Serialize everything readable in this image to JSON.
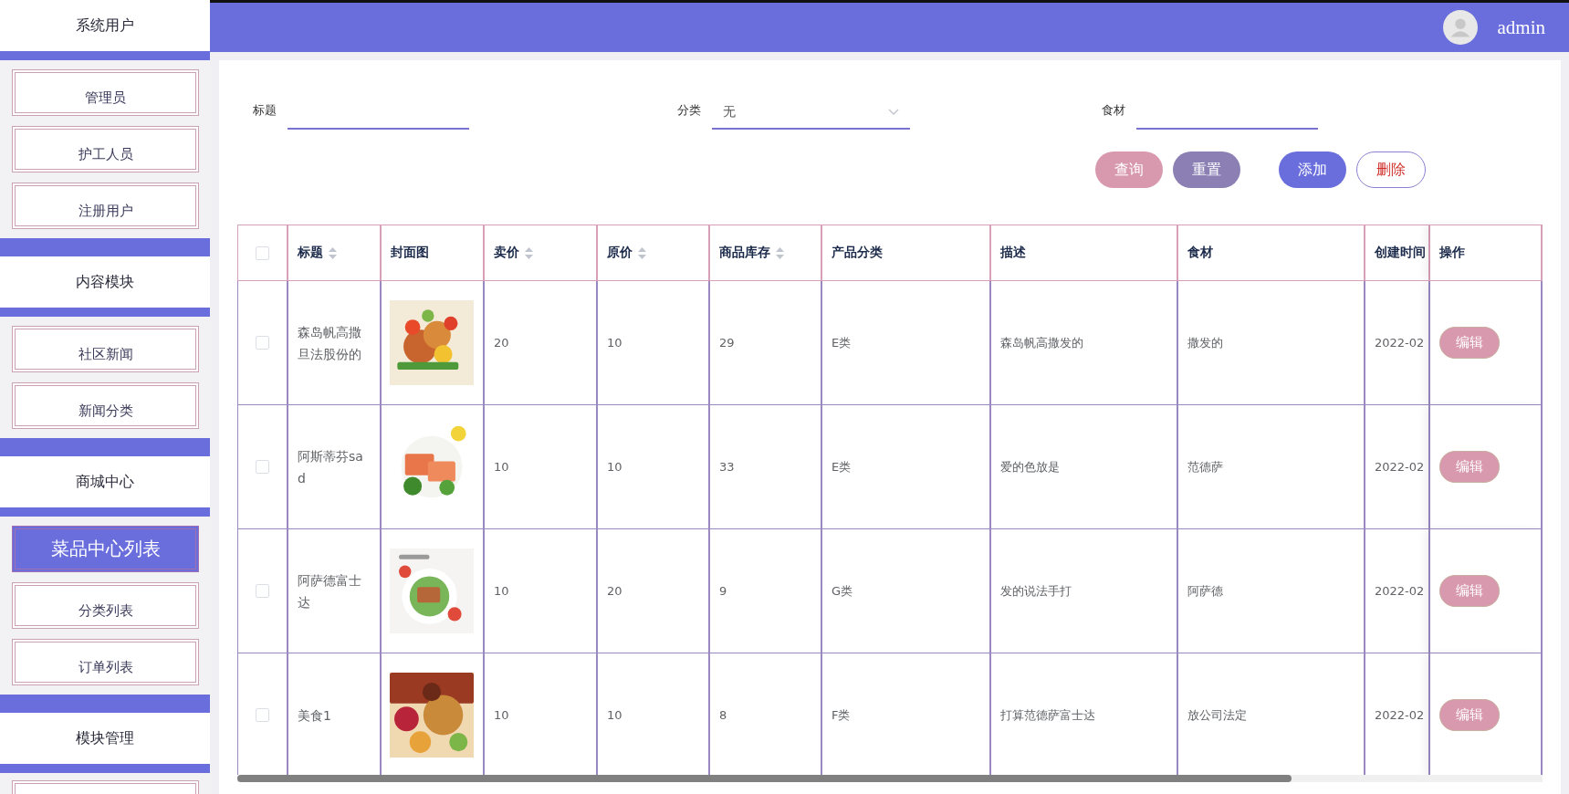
{
  "sidebar": {
    "sections": [
      {
        "title": "系统用户",
        "items": [
          {
            "label": "管理员",
            "selected": false
          },
          {
            "label": "护工人员",
            "selected": false
          },
          {
            "label": "注册用户",
            "selected": false
          }
        ]
      },
      {
        "title": "内容模块",
        "items": [
          {
            "label": "社区新闻",
            "selected": false
          },
          {
            "label": "新闻分类",
            "selected": false
          }
        ]
      },
      {
        "title": "商城中心",
        "items": [
          {
            "label": "菜品中心列表",
            "selected": true
          },
          {
            "label": "分类列表",
            "selected": false
          },
          {
            "label": "订单列表",
            "selected": false
          }
        ]
      },
      {
        "title": "模块管理"
      }
    ]
  },
  "topbar": {
    "username": "admin"
  },
  "filters": [
    {
      "label": "标题",
      "kind": "input"
    },
    {
      "label": "分类",
      "kind": "select",
      "value": "无"
    },
    {
      "label": "食材",
      "kind": "input"
    }
  ],
  "buttons": [
    {
      "label": "查询",
      "kind": "search"
    },
    {
      "label": "重置",
      "kind": "reset"
    },
    {
      "label": "添加",
      "kind": "add"
    },
    {
      "label": "删除",
      "kind": "delete"
    }
  ],
  "table": {
    "select_all_checked": false,
    "columns": [
      {
        "title": "标题",
        "sortable": true
      },
      {
        "title": "封面图",
        "sortable": false
      },
      {
        "title": "卖价",
        "sortable": true
      },
      {
        "title": "原价",
        "sortable": true
      },
      {
        "title": "商品库存",
        "sortable": true
      },
      {
        "title": "产品分类",
        "sortable": false
      },
      {
        "title": "描述",
        "sortable": false
      },
      {
        "title": "食材",
        "sortable": false
      },
      {
        "title": "创建时间",
        "sortable": false
      },
      {
        "title": "操作",
        "sortable": false
      }
    ],
    "rows": [
      {
        "checked": false,
        "cells": [
          "森岛帆高撒旦法股份的",
          {
            "kind": "picture"
          },
          "20",
          "10",
          "29",
          "E类",
          "森岛帆高撒发的",
          "撒发的",
          "2022-02"
        ],
        "action": "编辑"
      },
      {
        "checked": false,
        "cells": [
          "阿斯蒂芬sad",
          {
            "kind": "picture"
          },
          "10",
          "10",
          "33",
          "E类",
          "爱的色放是",
          "范德萨",
          "2022-02"
        ],
        "action": "编辑"
      },
      {
        "checked": false,
        "cells": [
          "阿萨德富士达",
          {
            "kind": "picture"
          },
          "10",
          "20",
          "9",
          "G类",
          "发的说法手打",
          "阿萨德",
          "2022-02"
        ],
        "action": "编辑"
      },
      {
        "checked": false,
        "cells": [
          "美食1",
          {
            "kind": "picture"
          },
          "10",
          "10",
          "8",
          "F类",
          "打算范德萨富士达",
          "放公司法定",
          "2022-02"
        ],
        "action": "编辑"
      }
    ]
  }
}
